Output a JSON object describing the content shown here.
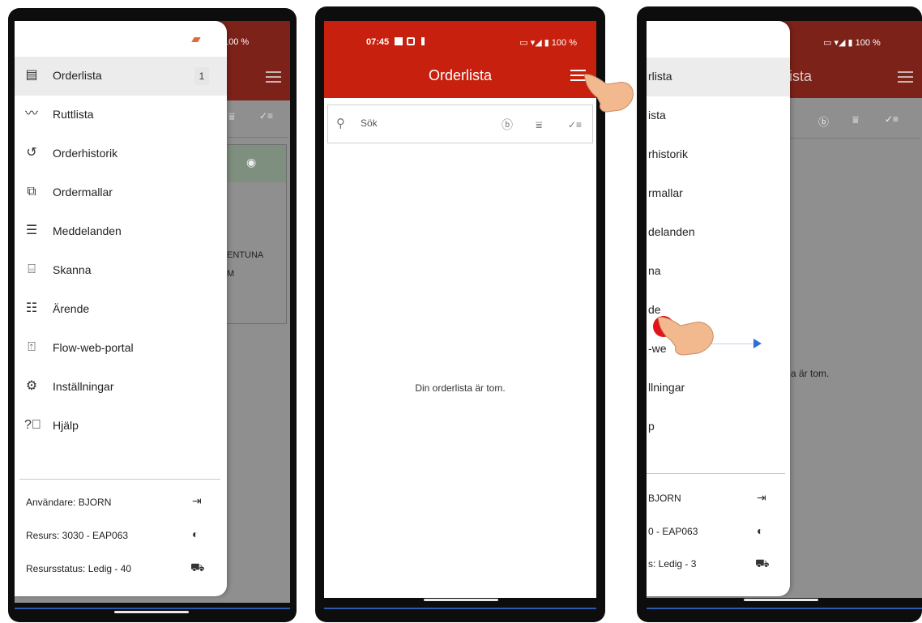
{
  "app": {
    "title": "Orderlista",
    "status_time": "07:45",
    "battery": "100 %",
    "empty_message": "Din orderlista är tom.",
    "search_placeholder": "Sök"
  },
  "menu": {
    "items": [
      {
        "label": "Orderlista",
        "icon": "order-list-icon",
        "badge": "1",
        "active": true
      },
      {
        "label": "Ruttlista",
        "icon": "route-icon"
      },
      {
        "label": "Orderhistorik",
        "icon": "history-icon"
      },
      {
        "label": "Ordermallar",
        "icon": "book-icon"
      },
      {
        "label": "Meddelanden",
        "icon": "message-icon"
      },
      {
        "label": "Skanna",
        "icon": "scan-icon"
      },
      {
        "label": "Ärende",
        "icon": "case-icon"
      },
      {
        "label": "Flow-web-portal",
        "icon": "portal-icon"
      },
      {
        "label": "Inställningar",
        "icon": "gear-icon"
      },
      {
        "label": "Hjälp",
        "icon": "help-icon"
      }
    ],
    "footer": {
      "user": "Användare: BJORN",
      "resource": "Resurs: 3030 - EAP063",
      "status": "Resursstatus: Ledig - 40"
    }
  },
  "phone3": {
    "items": [
      "rlista",
      "ista",
      "rhistorik",
      "rmallar",
      "delanden",
      "na",
      "de",
      "-we",
      "llningar",
      "p"
    ],
    "footer": [
      "BJORN",
      "0 - EAP063",
      "s: Ledig - 3"
    ],
    "header_fragment": "ista",
    "empty_fragment": "a är tom."
  },
  "phone1_background": {
    "text1": "ENTUNA",
    "text2": "M"
  },
  "colors": {
    "brand_red": "#c8200e",
    "dim_gray": "#8f8f8f"
  }
}
